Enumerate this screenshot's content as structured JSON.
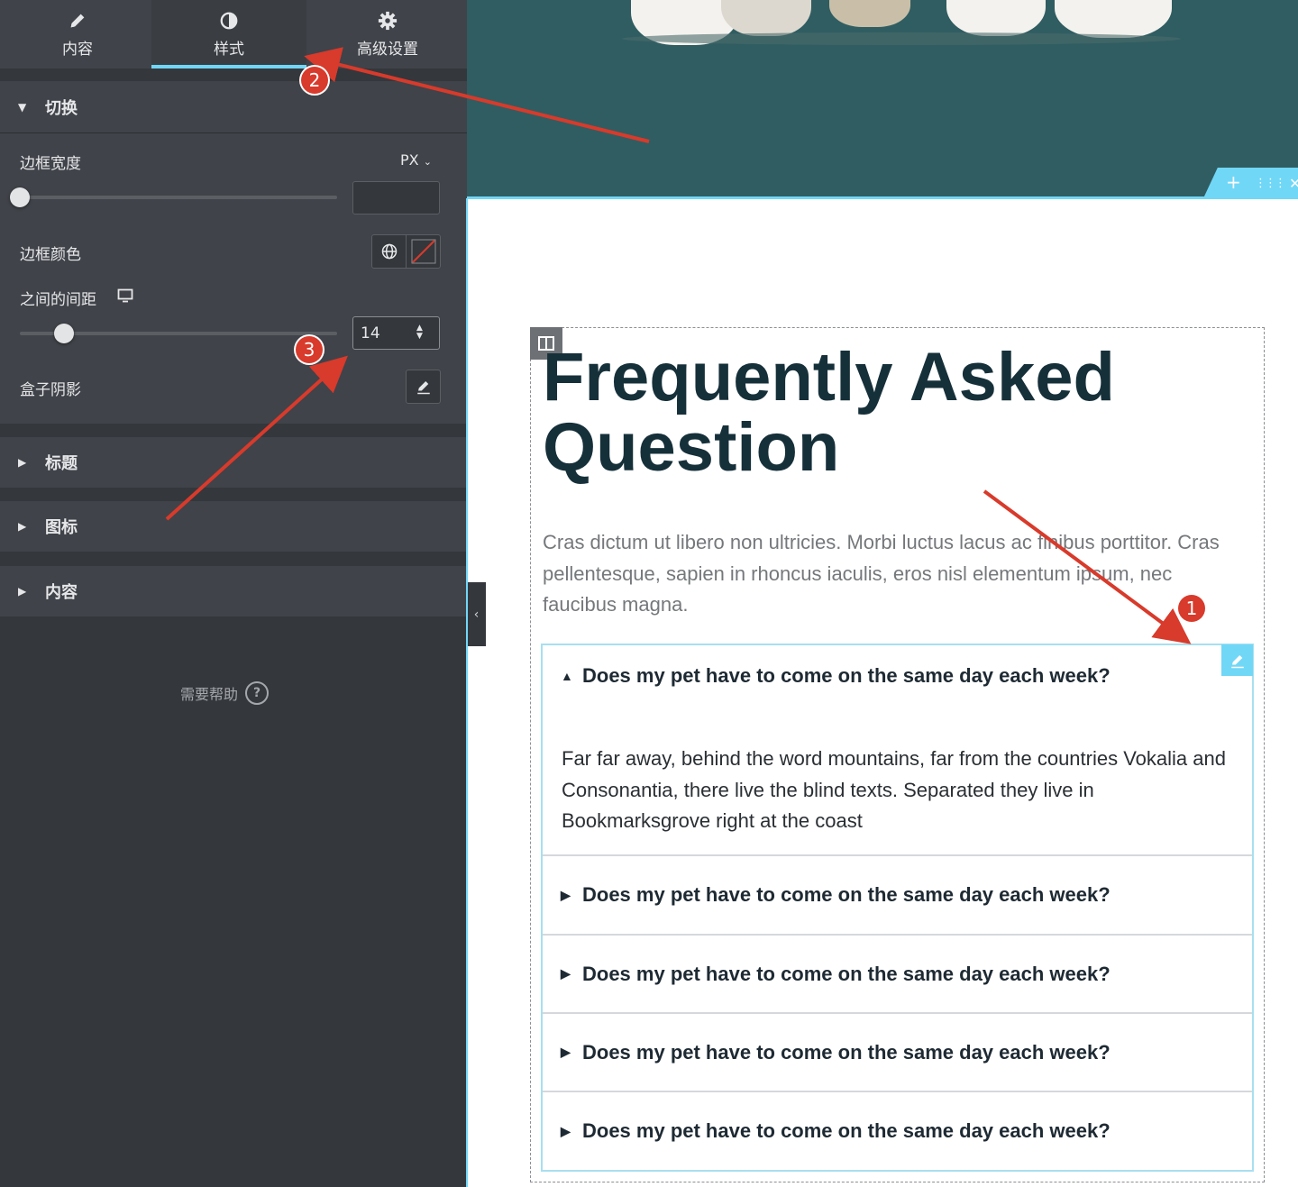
{
  "panel": {
    "tabs": [
      {
        "label": "内容",
        "icon": "pencil-icon"
      },
      {
        "label": "样式",
        "icon": "contrast-icon"
      },
      {
        "label": "高级设置",
        "icon": "gear-icon"
      }
    ],
    "active_tab": "样式",
    "section_toggle": {
      "title": "切换",
      "border_width_label": "边框宽度",
      "unit": "PX",
      "border_width_value": "",
      "border_color_label": "边框颜色",
      "spacing_label": "之间的间距",
      "spacing_value": "14",
      "box_shadow_label": "盒子阴影"
    },
    "collapsed_sections": [
      "标题",
      "图标",
      "内容"
    ],
    "help_label": "需要帮助",
    "help_icon": "?"
  },
  "canvas": {
    "faq_title": "Frequently Asked Question",
    "faq_intro": "Cras dictum ut libero non ultricies. Morbi luctus lacus ac finibus porttitor. Cras pellentesque, sapien in rhoncus iaculis, eros nisl elementum ipsum, nec faucibus magna.",
    "accordion": {
      "items": [
        "Does my pet have to come on the same day each week?",
        "Does my pet have to come on the same day each week?",
        "Does my pet have to come on the same day each week?",
        "Does my pet have to come on the same day each week?",
        "Does my pet have to come on the same day each week?"
      ],
      "open_item_body": "Far far away, behind the word mountains, far from the countries Vokalia and Consonantia, there live the blind texts. Separated they live in Bookmarksgrove right at the coast"
    },
    "section_tools": {
      "add": "+",
      "move": "⋮⋮⋮",
      "close": "✕"
    }
  },
  "annotations": {
    "badges": [
      "1",
      "2",
      "3"
    ],
    "color": "#d83a2b"
  },
  "colors": {
    "panel_bg": "#34373c",
    "panel_section_bg": "#404349",
    "accent": "#71d7f7",
    "hero_bg": "#305d61",
    "title_color": "#16303a"
  }
}
